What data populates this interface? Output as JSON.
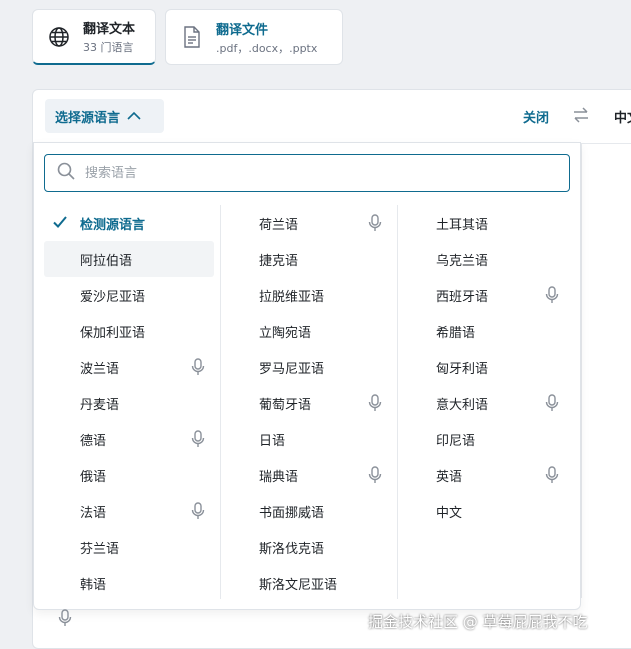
{
  "mode_tabs": [
    {
      "title": "翻译文本",
      "subtitle": "33 门语言"
    },
    {
      "title": "翻译文件",
      "subtitle": ".pdf，.docx，.pptx"
    }
  ],
  "topbar": {
    "source_button": "选择源语言",
    "close_label": "关闭",
    "target_lang": "中文"
  },
  "search": {
    "placeholder": "搜索语言",
    "value": ""
  },
  "columns": [
    [
      {
        "label": "检测源语言",
        "selected": true,
        "mic": false
      },
      {
        "label": "阿拉伯语",
        "mic": false
      },
      {
        "label": "爱沙尼亚语",
        "mic": false
      },
      {
        "label": "保加利亚语",
        "mic": false
      },
      {
        "label": "波兰语",
        "mic": true
      },
      {
        "label": "丹麦语",
        "mic": false
      },
      {
        "label": "德语",
        "mic": true
      },
      {
        "label": "俄语",
        "mic": false
      },
      {
        "label": "法语",
        "mic": true
      },
      {
        "label": "芬兰语",
        "mic": false
      },
      {
        "label": "韩语",
        "mic": false
      }
    ],
    [
      {
        "label": "荷兰语",
        "mic": true
      },
      {
        "label": "捷克语",
        "mic": false
      },
      {
        "label": "拉脱维亚语",
        "mic": false
      },
      {
        "label": "立陶宛语",
        "mic": false
      },
      {
        "label": "罗马尼亚语",
        "mic": false
      },
      {
        "label": "葡萄牙语",
        "mic": true
      },
      {
        "label": "日语",
        "mic": false
      },
      {
        "label": "瑞典语",
        "mic": true
      },
      {
        "label": "书面挪威语",
        "mic": false
      },
      {
        "label": "斯洛伐克语",
        "mic": false
      },
      {
        "label": "斯洛文尼亚语",
        "mic": false
      }
    ],
    [
      {
        "label": "土耳其语",
        "mic": false
      },
      {
        "label": "乌克兰语",
        "mic": false
      },
      {
        "label": "西班牙语",
        "mic": true
      },
      {
        "label": "希腊语",
        "mic": false
      },
      {
        "label": "匈牙利语",
        "mic": false
      },
      {
        "label": "意大利语",
        "mic": true
      },
      {
        "label": "印尼语",
        "mic": false
      },
      {
        "label": "英语",
        "mic": true
      },
      {
        "label": "中文",
        "mic": false
      }
    ]
  ],
  "watermark": "掘金技术社区 @ 草莓屁屁我不吃",
  "colors": {
    "accent": "#0f6b8f",
    "mic": "#8a9099"
  }
}
